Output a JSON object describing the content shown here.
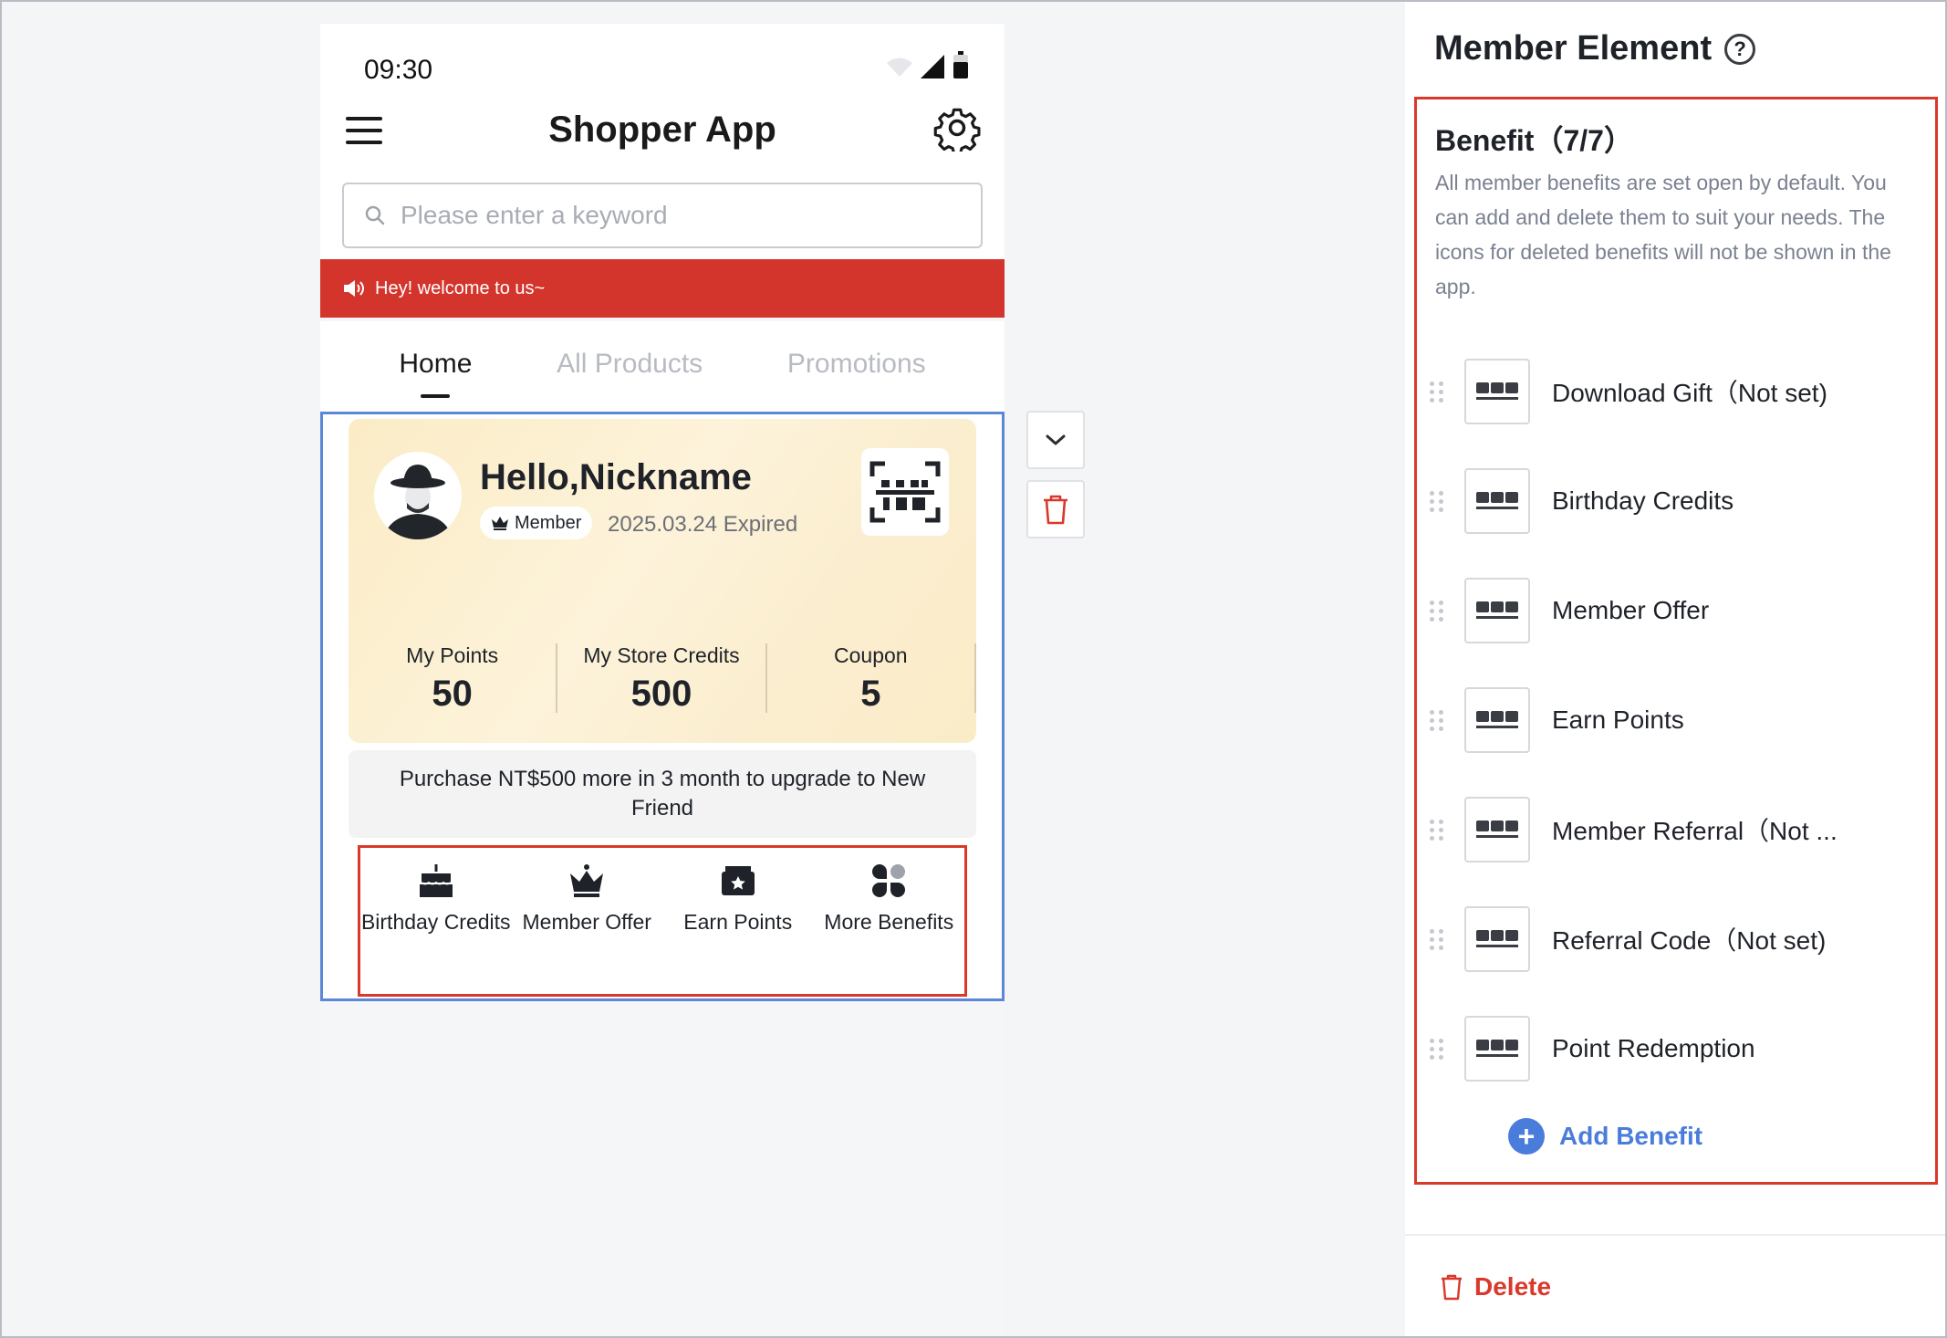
{
  "phone": {
    "time": "09:30",
    "app_title": "Shopper App",
    "search_placeholder": "Please enter a keyword",
    "banner_text": "Hey! welcome to us~",
    "tabs": [
      {
        "label": "Home",
        "active": true
      },
      {
        "label": "All Products",
        "active": false
      },
      {
        "label": "Promotions",
        "active": false
      }
    ]
  },
  "member_card": {
    "greeting": "Hello,Nickname",
    "badge": "Member",
    "expiry": "2025.03.24 Expired",
    "stats": [
      {
        "label": "My Points",
        "value": "50"
      },
      {
        "label": "My Store Credits",
        "value": "500"
      },
      {
        "label": "Coupon",
        "value": "5"
      }
    ],
    "upgrade_text": "Purchase NT$500 more in 3 month to upgrade to New Friend",
    "benefits": [
      {
        "label": "Birthday Credits",
        "icon": "cake-icon"
      },
      {
        "label": "Member Offer",
        "icon": "crown-icon"
      },
      {
        "label": "Earn Points",
        "icon": "ticket-icon"
      },
      {
        "label": "More Benefits",
        "icon": "grid-icon"
      }
    ]
  },
  "panel": {
    "title": "Member Element",
    "benefit_heading": "Benefit（7/7）",
    "description": "All member benefits are set open by default. You can add and delete them to suit your needs. The icons for deleted benefits will not be shown in the app.",
    "benefits": [
      {
        "label": "Download Gift（Not set)"
      },
      {
        "label": "Birthday Credits"
      },
      {
        "label": "Member Offer"
      },
      {
        "label": "Earn Points"
      },
      {
        "label": "Member Referral（Not ..."
      },
      {
        "label": "Referral Code（Not set)"
      },
      {
        "label": "Point Redemption"
      }
    ],
    "add_label": "Add Benefit",
    "delete_label": "Delete"
  },
  "colors": {
    "accent_red": "#d9382b",
    "banner_red": "#d3352c",
    "selection_blue": "#5b87d9",
    "link_blue": "#4a7ddb",
    "card_gold": "#fbecc6"
  }
}
